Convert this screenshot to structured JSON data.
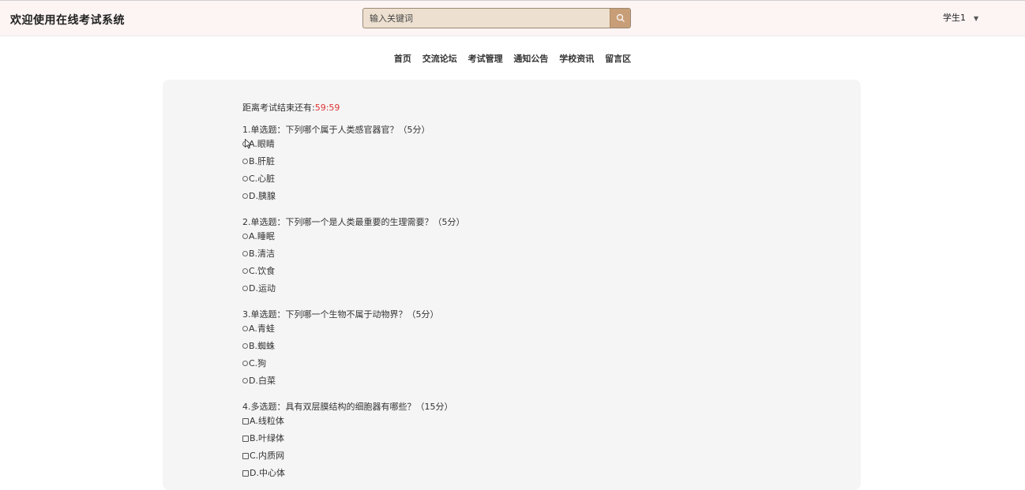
{
  "header": {
    "site_title": "欢迎使用在线考试系统",
    "search_placeholder": "输入关键词",
    "user_name": "学生1",
    "user_caret": "▼"
  },
  "nav": {
    "items": [
      "首页",
      "交流论坛",
      "考试管理",
      "通知公告",
      "学校资讯",
      "留言区"
    ]
  },
  "exam": {
    "timer_label": "距离考试结束还有:",
    "timer_value": "59:59",
    "questions": [
      {
        "title": "1.单选题：下列哪个属于人类感官器官？（5分）",
        "type": "radio",
        "options": [
          "A.眼睛",
          "B.肝脏",
          "C.心脏",
          "D.胰腺"
        ]
      },
      {
        "title": "2.单选题：下列哪一个是人类最重要的生理需要？（5分）",
        "type": "radio",
        "options": [
          "A.睡眠",
          "B.清洁",
          "C.饮食",
          "D.运动"
        ]
      },
      {
        "title": "3.单选题：下列哪一个生物不属于动物界？（5分）",
        "type": "radio",
        "options": [
          "A.青蛙",
          "B.蜘蛛",
          "C.狗",
          "D.白菜"
        ]
      },
      {
        "title": "4.多选题：具有双层膜结构的细胞器有哪些？（15分）",
        "type": "checkbox",
        "options": [
          "A.线粒体",
          "B.叶绿体",
          "C.内质网",
          "D.中心体"
        ]
      }
    ]
  }
}
